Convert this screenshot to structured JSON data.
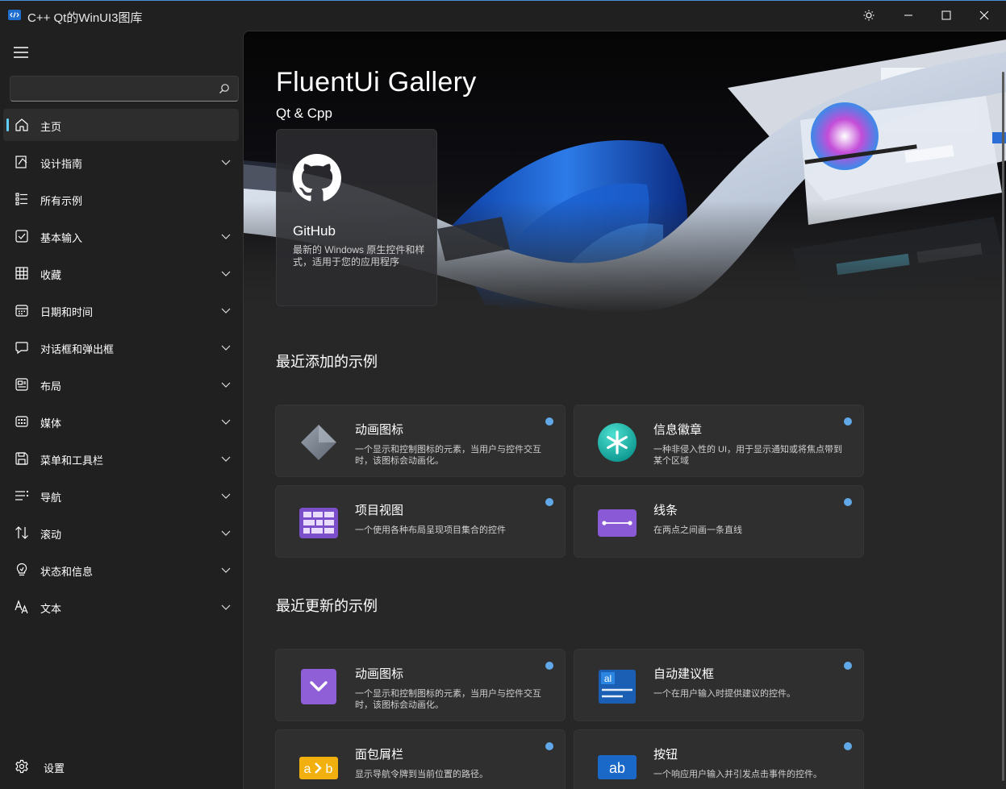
{
  "window": {
    "title": "C++ Qt的WinUI3图库"
  },
  "search": {
    "value": "",
    "placeholder": ""
  },
  "sidebar": {
    "items": [
      {
        "label": "主页",
        "icon": "home-icon",
        "selected": true,
        "expandable": false
      },
      {
        "label": "设计指南",
        "icon": "design-guide-icon",
        "expandable": true
      },
      {
        "label": "所有示例",
        "icon": "list-icon",
        "expandable": false
      },
      {
        "label": "基本输入",
        "icon": "checkbox-icon",
        "expandable": true
      },
      {
        "label": "收藏",
        "icon": "grid-icon",
        "expandable": true
      },
      {
        "label": "日期和时间",
        "icon": "calendar-icon",
        "expandable": true
      },
      {
        "label": "对话框和弹出框",
        "icon": "chat-icon",
        "expandable": true
      },
      {
        "label": "布局",
        "icon": "layout-icon",
        "expandable": true
      },
      {
        "label": "媒体",
        "icon": "media-icon",
        "expandable": true
      },
      {
        "label": "菜单和工具栏",
        "icon": "save-icon",
        "expandable": true
      },
      {
        "label": "导航",
        "icon": "navigation-icon",
        "expandable": true
      },
      {
        "label": "滚动",
        "icon": "scroll-icon",
        "expandable": true
      },
      {
        "label": "状态和信息",
        "icon": "lightbulb-icon",
        "expandable": true
      },
      {
        "label": "文本",
        "icon": "text-icon",
        "expandable": true
      }
    ],
    "settings_label": "设置"
  },
  "hero": {
    "title": "FluentUi Gallery",
    "subtitle": "Qt & Cpp",
    "github_card": {
      "title": "GitHub",
      "description": "最新的 Windows 原生控件和样式，适用于您的应用程序"
    }
  },
  "sections": {
    "recently_added": {
      "title": "最近添加的示例",
      "cards": [
        {
          "title": "动画图标",
          "description": "一个显示和控制图标的元素，当用户与控件交互时，该图标会动画化。",
          "icon": "animated-icon"
        },
        {
          "title": "信息徽章",
          "description": "一种非侵入性的 UI，用于显示通知或将焦点带到某个区域",
          "icon": "info-badge-icon"
        },
        {
          "title": "项目视图",
          "description": "一个使用各种布局呈现项目集合的控件",
          "icon": "items-view-icon"
        },
        {
          "title": "线条",
          "description": "在两点之间画一条直线",
          "icon": "line-icon"
        }
      ]
    },
    "recently_updated": {
      "title": "最近更新的示例",
      "cards": [
        {
          "title": "动画图标",
          "description": "一个显示和控制图标的元素，当用户与控件交互时，该图标会动画化。",
          "icon": "animated-icon-purple"
        },
        {
          "title": "自动建议框",
          "description": "一个在用户输入时提供建议的控件。",
          "icon": "auto-suggest-icon"
        },
        {
          "title": "面包屑栏",
          "description": "显示导航令牌到当前位置的路径。",
          "icon": "breadcrumb-icon"
        },
        {
          "title": "按钮",
          "description": "一个响应用户输入并引发点击事件的控件。",
          "icon": "button-icon"
        }
      ]
    }
  },
  "colors": {
    "accent": "#60cdff",
    "background": "#202020",
    "card": "#2f2f2f"
  }
}
